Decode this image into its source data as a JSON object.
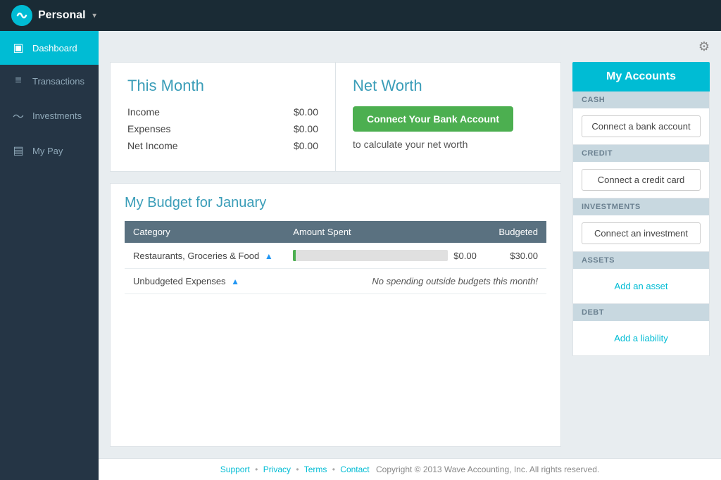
{
  "app": {
    "name": "Personal",
    "logo_char": "W"
  },
  "topnav": {
    "settings_icon": "⚙"
  },
  "sidebar": {
    "items": [
      {
        "id": "dashboard",
        "label": "Dashboard",
        "icon": "▣",
        "active": true
      },
      {
        "id": "transactions",
        "label": "Transactions",
        "icon": "≡",
        "active": false
      },
      {
        "id": "investments",
        "label": "Investments",
        "icon": "∿",
        "active": false
      },
      {
        "id": "mypay",
        "label": "My Pay",
        "icon": "▤",
        "active": false
      }
    ]
  },
  "this_month": {
    "title": "This Month",
    "rows": [
      {
        "label": "Income",
        "value": "$0.00"
      },
      {
        "label": "Expenses",
        "value": "$0.00"
      },
      {
        "label": "Net Income",
        "value": "$0.00"
      }
    ]
  },
  "net_worth": {
    "title": "Net Worth",
    "connect_btn": "Connect Your Bank Account",
    "subtitle": "to calculate your net worth"
  },
  "budget": {
    "title": "My Budget for January",
    "columns": [
      "Category",
      "Amount Spent",
      "Budgeted"
    ],
    "rows": [
      {
        "category": "Restaurants, Groceries & Food",
        "amount": "$0.00",
        "budgeted": "$30.00",
        "bar_percent": 2
      },
      {
        "category": "Unbudgeted Expenses",
        "amount": null,
        "no_spending": "No spending outside budgets this month!",
        "budgeted": null
      }
    ]
  },
  "my_accounts": {
    "header": "My Accounts",
    "sections": [
      {
        "id": "cash",
        "label": "CASH",
        "action": "Connect a bank account",
        "action_type": "button"
      },
      {
        "id": "credit",
        "label": "CREDIT",
        "action": "Connect a credit card",
        "action_type": "button"
      },
      {
        "id": "investments",
        "label": "INVESTMENTS",
        "action": "Connect an investment",
        "action_type": "button"
      },
      {
        "id": "assets",
        "label": "ASSETS",
        "action": "Add an asset",
        "action_type": "link"
      },
      {
        "id": "debt",
        "label": "DEBT",
        "action": "Add a liability",
        "action_type": "link"
      }
    ]
  },
  "footer": {
    "links": [
      "Support",
      "Privacy",
      "Terms",
      "Contact"
    ],
    "copyright": "Copyright © 2013 Wave Accounting, Inc. All rights reserved."
  }
}
